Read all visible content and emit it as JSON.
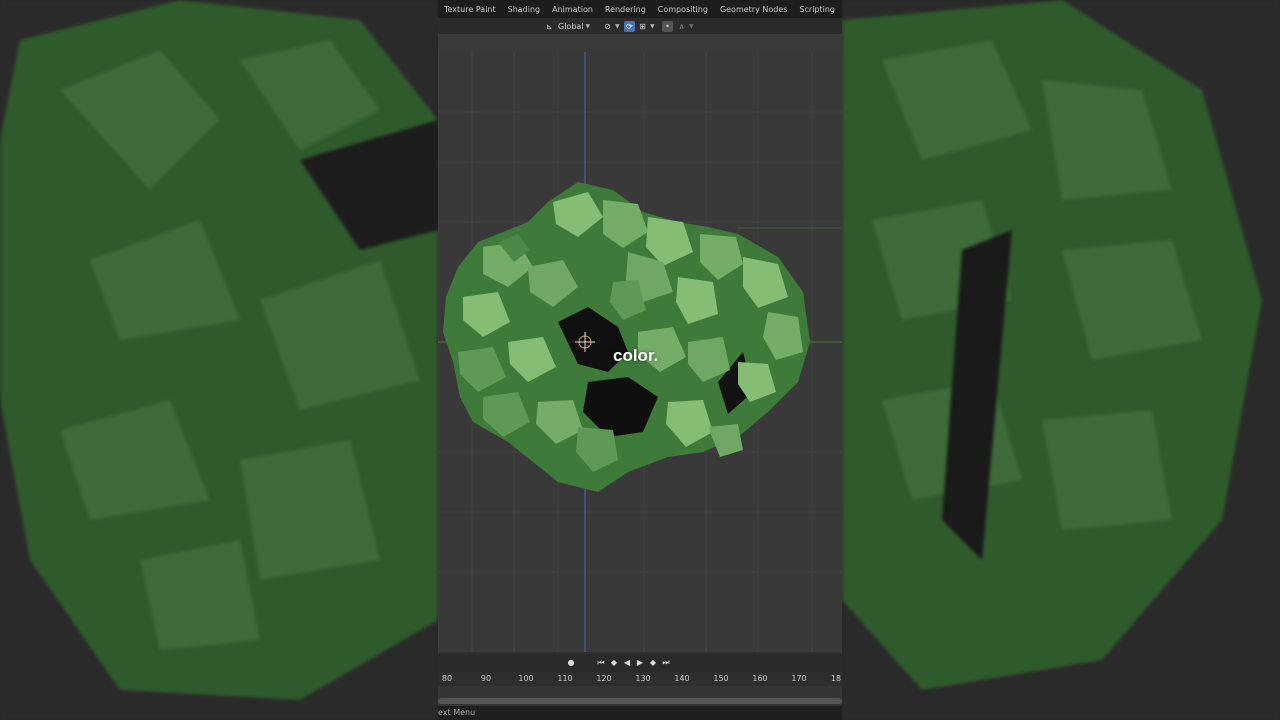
{
  "workspace_tabs": [
    "Texture Paint",
    "Shading",
    "Animation",
    "Rendering",
    "Compositing",
    "Geometry Nodes",
    "Scripting"
  ],
  "workspace_add": "+",
  "header": {
    "orientation_label": "Global",
    "transform_icon": "transform-orientation-icon",
    "snap_icon": "snap-icon",
    "proportional_icon": "proportional-edit-icon"
  },
  "caption": "color.",
  "timeline": {
    "record_icon": "record-icon",
    "controls": [
      "jump-start-icon",
      "prev-keyframe-icon",
      "play-reverse-icon",
      "play-icon",
      "next-keyframe-icon",
      "jump-end-icon"
    ],
    "ruler_ticks": [
      "80",
      "90",
      "100",
      "110",
      "120",
      "130",
      "140",
      "150",
      "160",
      "170",
      "18"
    ]
  },
  "status": {
    "text": "ext Menu"
  },
  "colors": {
    "foliage_dark": "#3e7a3a",
    "foliage_mid": "#5e9a55",
    "foliage_light": "#86bd74",
    "viewport_bg": "#393939",
    "x_axis": "#4b7a2d",
    "y_axis": "#3f6fa8"
  }
}
